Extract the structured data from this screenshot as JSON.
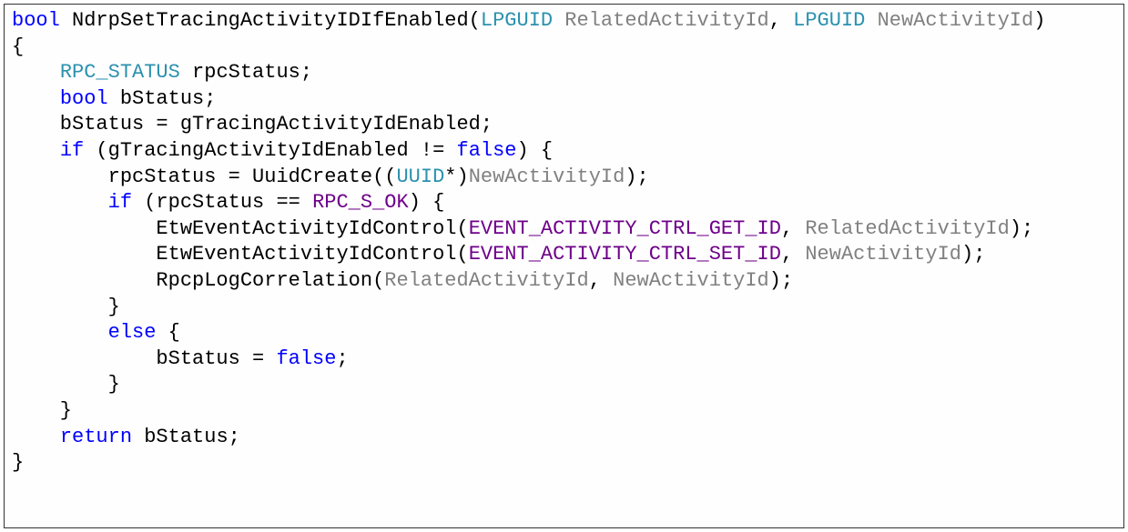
{
  "code": {
    "line1": {
      "t1": "bool",
      "t2": " NdrpSetTracingActivityIDIfEnabled(",
      "t3": "LPGUID",
      "t4": " RelatedActivityId",
      "t5": ", ",
      "t6": "LPGUID",
      "t7": " NewActivityId",
      "t8": ")"
    },
    "line2": "{",
    "line3": {
      "t1": "    ",
      "t2": "RPC_STATUS",
      "t3": " rpcStatus;"
    },
    "line4": {
      "t1": "    ",
      "t2": "bool",
      "t3": " bStatus;"
    },
    "line5": "",
    "line6": {
      "t1": "    bStatus = gTracingActivityIdEnabled;"
    },
    "line7": {
      "t1": "    ",
      "t2": "if",
      "t3": " (gTracingActivityIdEnabled != ",
      "t4": "false",
      "t5": ") {"
    },
    "line8": {
      "t1": "        rpcStatus = UuidCreate((",
      "t2": "UUID",
      "t3": "*)",
      "t4": "NewActivityId",
      "t5": ");"
    },
    "line9": {
      "t1": "        ",
      "t2": "if",
      "t3": " (rpcStatus == ",
      "t4": "RPC_S_OK",
      "t5": ") {"
    },
    "line10": {
      "t1": "            EtwEventActivityIdControl(",
      "t2": "EVENT_ACTIVITY_CTRL_GET_ID",
      "t3": ", ",
      "t4": "RelatedActivityId",
      "t5": ");"
    },
    "line11": {
      "t1": "            EtwEventActivityIdControl(",
      "t2": "EVENT_ACTIVITY_CTRL_SET_ID",
      "t3": ", ",
      "t4": "NewActivityId",
      "t5": ");"
    },
    "line12": {
      "t1": "            RpcpLogCorrelation(",
      "t2": "RelatedActivityId",
      "t3": ", ",
      "t4": "NewActivityId",
      "t5": ");"
    },
    "line13": "        }",
    "line14": {
      "t1": "        ",
      "t2": "else",
      "t3": " {"
    },
    "line15": {
      "t1": "            bStatus = ",
      "t2": "false",
      "t3": ";"
    },
    "line16": "        }",
    "line17": "    }",
    "line18": {
      "t1": "    ",
      "t2": "return",
      "t3": " bStatus;"
    },
    "line19": "}"
  }
}
